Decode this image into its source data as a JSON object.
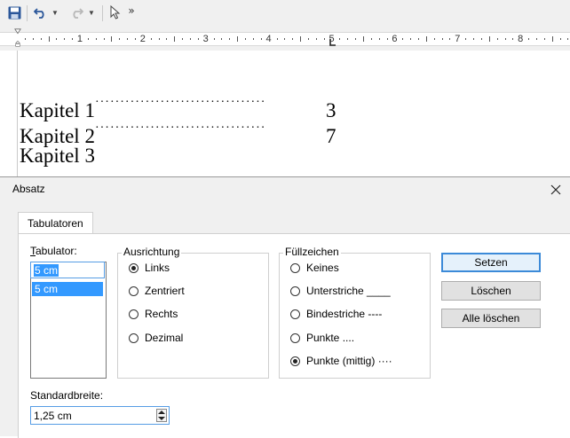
{
  "toolbar": {
    "icons": [
      "save-icon",
      "undo-icon",
      "redo-icon",
      "selection-pointer-icon"
    ],
    "more_label": "»"
  },
  "ruler": {
    "numbers": [
      "1",
      "2",
      "3",
      "4",
      "5",
      "6",
      "7",
      "8"
    ]
  },
  "document": {
    "lines": [
      {
        "text": "Kapitel 1",
        "leader": "··································",
        "page": "3"
      },
      {
        "text": "Kapitel 2",
        "leader": "··································",
        "page": "7"
      },
      {
        "text": "Kapitel 3",
        "leader": "",
        "page": ""
      }
    ]
  },
  "dialog": {
    "title": "Absatz",
    "tab": "Tabulatoren",
    "tabulator": {
      "label": "Tabulator:",
      "value": "5 cm",
      "list": [
        "5 cm"
      ]
    },
    "ausrichtung": {
      "title": "Ausrichtung",
      "options": [
        {
          "label": "Links",
          "selected": true
        },
        {
          "label": "Zentriert",
          "selected": false
        },
        {
          "label": "Rechts",
          "selected": false
        },
        {
          "label": "Dezimal",
          "selected": false
        }
      ]
    },
    "fuellzeichen": {
      "title": "Füllzeichen",
      "options": [
        {
          "label": "Keines",
          "selected": false
        },
        {
          "label": "Unterstriche ____",
          "selected": false
        },
        {
          "label": "Bindestriche ----",
          "selected": false
        },
        {
          "label": "Punkte ....",
          "selected": false
        },
        {
          "label": "Punkte (mittig) ····",
          "selected": true
        }
      ]
    },
    "buttons": {
      "set": "Setzen",
      "delete": "Löschen",
      "delete_all": "Alle löschen"
    },
    "standardbreite": {
      "label": "Standardbreite:",
      "value": "1,25 cm"
    }
  }
}
